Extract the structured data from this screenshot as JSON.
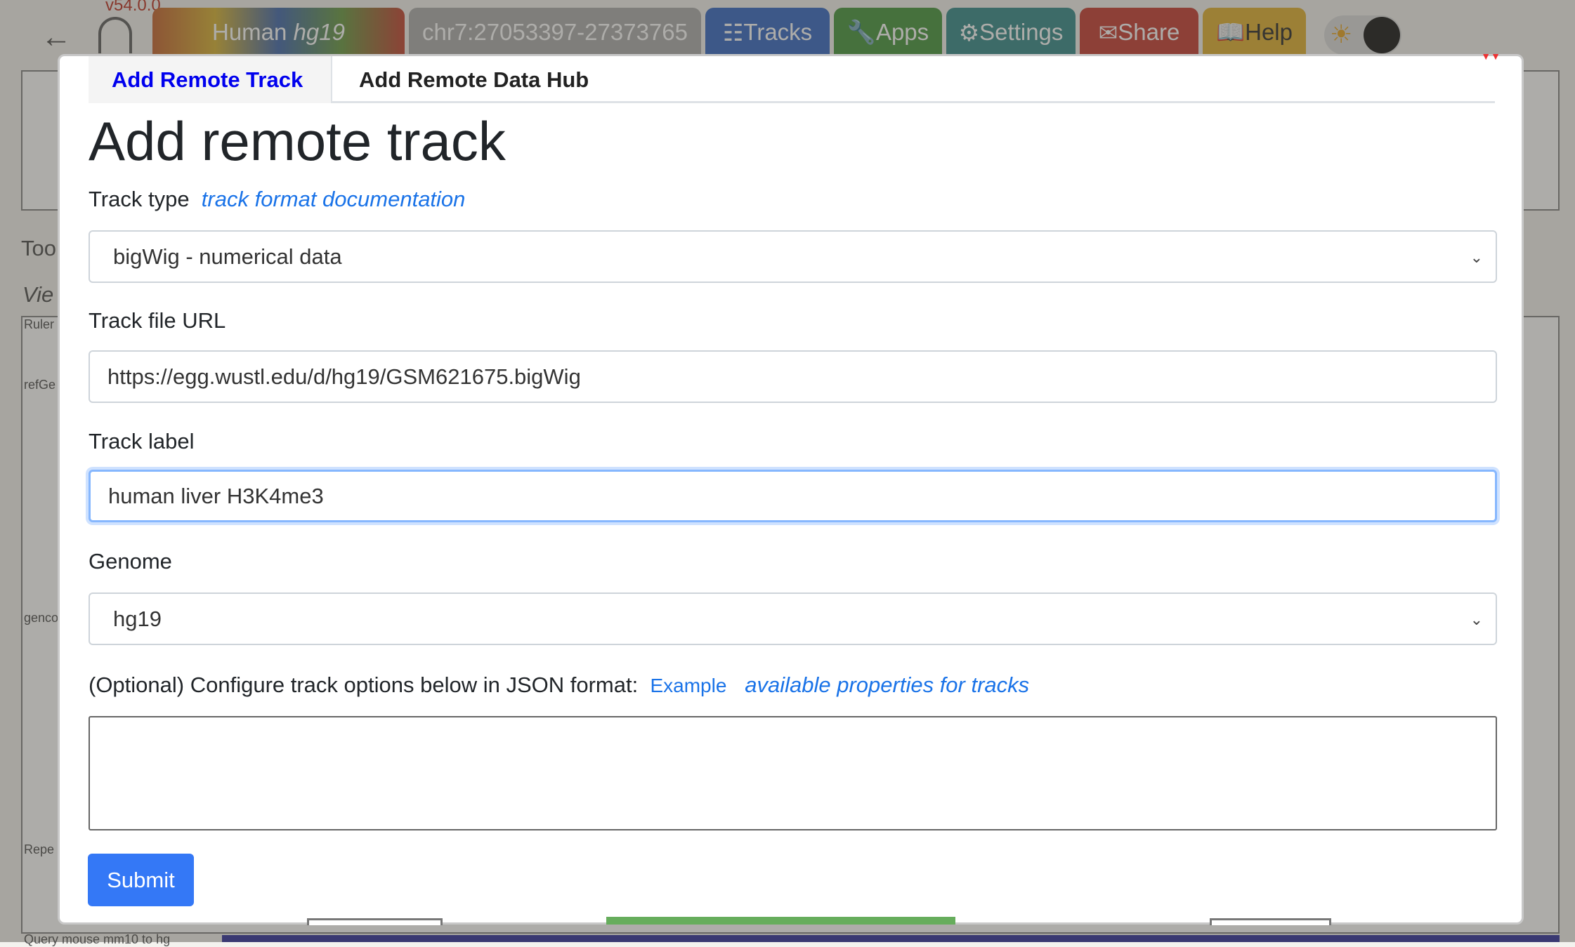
{
  "header": {
    "version": "v54.0.0",
    "genome_tab": {
      "species": "Human",
      "assembly": "hg19"
    },
    "locus": "chr7:27053397-27373765",
    "nav": [
      {
        "icon": "piano-icon",
        "label": "Tracks",
        "color": "#3f6fc6"
      },
      {
        "icon": "wrench-icon",
        "label": "Apps",
        "color": "#4f9a45"
      },
      {
        "icon": "gear-icon",
        "label": "Settings",
        "color": "#3f8f8f"
      },
      {
        "icon": "envelope-icon",
        "label": "Share",
        "color": "#c8453c"
      },
      {
        "icon": "book-icon",
        "label": "Help",
        "color": "#e2b43a"
      }
    ]
  },
  "background": {
    "section_partial": "Too",
    "view_partial": "Vie",
    "track_labels": [
      "Ruler",
      "refGe",
      "genco",
      "Repe",
      "Query mouse mm10 to hg"
    ]
  },
  "modal": {
    "tabs": [
      {
        "label": "Add Remote Track",
        "active": true
      },
      {
        "label": "Add Remote Data Hub",
        "active": false
      }
    ],
    "title": "Add remote track",
    "track_type_label": "Track type",
    "track_doc_link": "track format documentation",
    "track_type_value": "bigWig - numerical data",
    "url_label": "Track file URL",
    "url_value": "https://egg.wustl.edu/d/hg19/GSM621675.bigWig",
    "track_label_label": "Track label",
    "track_label_value": "human liver H3K4me3",
    "genome_label": "Genome",
    "genome_value": "hg19",
    "options_label": "(Optional) Configure track options below in JSON format:",
    "example_link": "Example",
    "properties_link": "available properties for tracks",
    "options_value": "",
    "submit": "Submit"
  },
  "colors": {
    "primary": "#3478f6",
    "active_tab": "#0000ee",
    "link": "#1a73e8"
  }
}
